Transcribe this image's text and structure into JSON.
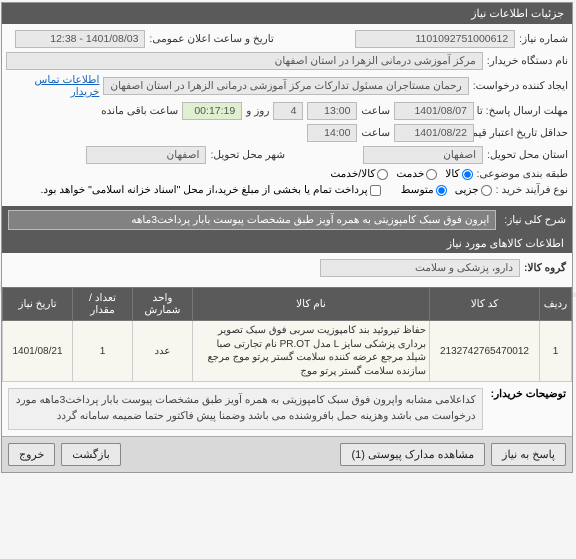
{
  "panel_title": "جزئیات اطلاعات نیاز",
  "fields": {
    "need_number_label": "شماره نیاز:",
    "need_number": "1101092751000612",
    "announce_label": "تاریخ و ساعت اعلان عمومی:",
    "announce_value": "1401/08/03 - 12:38",
    "buyer_org_label": "نام دستگاه خریدار:",
    "buyer_org": "مرکز آموزشی درمانی الزهرا در استان اصفهان",
    "requester_label": "ایجاد کننده درخواست:",
    "requester": "رحمان مستاجران مسئول تدارکات مرکز آموزشی درمانی الزهرا در استان اصفهان",
    "contact_link": "اطلاعات تماس خریدار",
    "reply_deadline_label": "مهلت ارسال پاسخ: تا تاریخ:",
    "reply_deadline_date": "1401/08/07",
    "time_label": "ساعت",
    "reply_deadline_time": "13:00",
    "days_label": "روز و",
    "days_value": "4",
    "remaining_time": "00:17:19",
    "remaining_label": "ساعت باقی مانده",
    "price_valid_label": "حداقل تاریخ اعتبار قیمت: تا تاریخ:",
    "price_valid_date": "1401/08/22",
    "price_valid_time": "14:00",
    "city_label": "شهر محل تحویل:",
    "city_value": "اصفهان",
    "province_label": "استان محل تحویل:",
    "province_value": "اصفهان",
    "category_label": "طبقه بندی موضوعی:",
    "cat_goods": "کالا",
    "cat_service": "خدمت",
    "cat_goods_service": "کالا/خدمت",
    "purchase_type_label": "نوع فرآیند خرید :",
    "pt_small": "جزیی",
    "pt_medium": "متوسط",
    "payment_note": "پرداخت تمام یا بخشی از مبلغ خرید،از محل \"اسناد خزانه اسلامی\" خواهد بود.",
    "need_desc_label": "شرح کلی نیاز:",
    "need_desc": "اپرون فوق سبک کامپوزیتی  به همره آویز طبق مشخصات پیوست بابار پرداخت3ماهه",
    "goods_section_title": "اطلاعات کالاهای مورد نیاز",
    "goods_group_label": "گروه کالا:",
    "goods_group": "دارو، پزشکی و سلامت"
  },
  "table": {
    "headers": {
      "row": "ردیف",
      "code": "کد کالا",
      "name": "نام کالا",
      "unit": "واحد شمارش",
      "qty": "تعداد / مقدار",
      "date": "تاریخ نیاز"
    },
    "rows": [
      {
        "row": "1",
        "code": "2132742765470012",
        "name": "حفاظ تیروئید بند کامپوزیت سربی فوق سبک تصویر برداری پزشکی سایز L مدل PR.OT نام تجارتی صبا شیلد مرجع عرضه کننده سلامت گستر پرتو موج مرجع سازنده سلامت گستر پرتو موج",
        "unit": "عدد",
        "qty": "1",
        "date": "1401/08/21"
      }
    ]
  },
  "notes": {
    "label": "توضیحات خریدار:",
    "text": "کداعلامی مشابه واپرون فوق سبک کامپوزیتی  به همره آویز طبق مشخصات پیوست بابار پرداخت3ماهه مورد درخواست می باشد وهزینه حمل بافروشنده می باشد وضمنا پیش فاکتور حتما ضمیمه سامانه گردد"
  },
  "footer": {
    "reply": "پاسخ به نیاز",
    "attachments": "مشاهده مدارک پیوستی (1)",
    "back": "بازگشت",
    "exit": "خروج"
  }
}
